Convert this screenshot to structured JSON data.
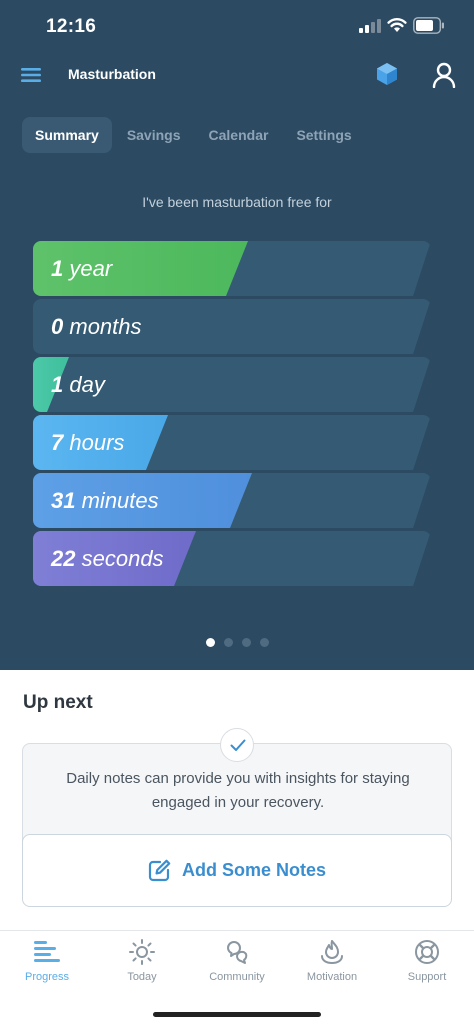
{
  "status_bar": {
    "time": "12:16"
  },
  "header": {
    "title": "Masturbation"
  },
  "tabs": [
    {
      "label": "Summary",
      "active": true
    },
    {
      "label": "Savings",
      "active": false
    },
    {
      "label": "Calendar",
      "active": false
    },
    {
      "label": "Settings",
      "active": false
    }
  ],
  "summary": {
    "subtitle": "I've been masturbation free for",
    "counters": [
      {
        "number": "1",
        "unit": "year",
        "fill_fraction": 0.54,
        "color_from": "#5ec26a",
        "color_to": "#4cb85c"
      },
      {
        "number": "0",
        "unit": "months",
        "fill_fraction": 0.0,
        "color_from": "#355a74",
        "color_to": "#355a74"
      },
      {
        "number": "1",
        "unit": "day",
        "fill_fraction": 0.09,
        "color_from": "#4cc9a8",
        "color_to": "#3fbf9c"
      },
      {
        "number": "7",
        "unit": "hours",
        "fill_fraction": 0.34,
        "color_from": "#5bb6f0",
        "color_to": "#4aa8e8"
      },
      {
        "number": "31",
        "unit": "minutes",
        "fill_fraction": 0.55,
        "color_from": "#5ea0e6",
        "color_to": "#4f8fdc"
      },
      {
        "number": "22",
        "unit": "seconds",
        "fill_fraction": 0.41,
        "color_from": "#7f7fd6",
        "color_to": "#6f6bc9"
      }
    ],
    "page_dots": {
      "count": 4,
      "active_index": 0
    }
  },
  "up_next": {
    "heading": "Up next",
    "message": "Daily notes can provide you with insights for staying engaged in your recovery.",
    "action_label": "Add Some Notes"
  },
  "bottom_nav": [
    {
      "label": "Progress",
      "icon": "progress-icon",
      "active": true
    },
    {
      "label": "Today",
      "icon": "sun-icon",
      "active": false
    },
    {
      "label": "Community",
      "icon": "community-icon",
      "active": false
    },
    {
      "label": "Motivation",
      "icon": "motivation-icon",
      "active": false
    },
    {
      "label": "Support",
      "icon": "lifebuoy-icon",
      "active": false
    }
  ],
  "colors": {
    "panel_bg": "#2c4a62",
    "accent_blue": "#3a8ecf",
    "active_nav": "#5aaee8",
    "inactive_nav": "#8a96a0"
  }
}
